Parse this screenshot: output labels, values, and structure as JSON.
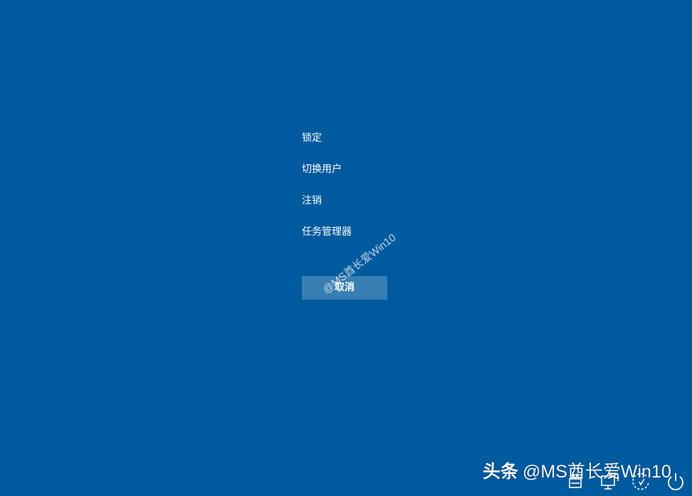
{
  "menu": {
    "items": [
      {
        "label": "锁定"
      },
      {
        "label": "切换用户"
      },
      {
        "label": "注销"
      },
      {
        "label": "任务管理器"
      }
    ]
  },
  "cancel_button": {
    "label": "取消"
  },
  "watermarks": {
    "center": "@MS酋长爱Win10",
    "bottom_brand": "头条",
    "bottom_handle": "@MS酋长爱Win10"
  },
  "tray": {
    "icons": [
      "accessibility-icon",
      "network-icon",
      "ease-of-access-icon",
      "power-icon"
    ]
  },
  "colors": {
    "background": "#005a9e",
    "text": "#ffffff"
  }
}
